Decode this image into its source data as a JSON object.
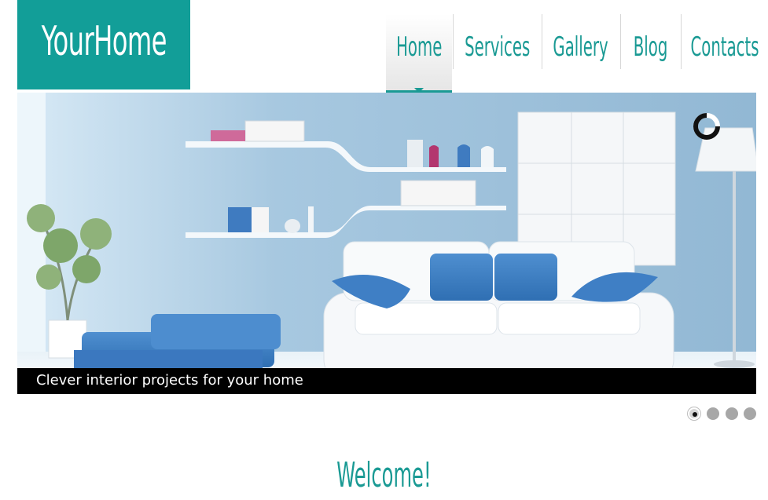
{
  "brand": {
    "logo_text": "YourHome",
    "accent_color": "#129e98"
  },
  "nav": {
    "items": [
      {
        "label": "Home",
        "active": true
      },
      {
        "label": "Services",
        "active": false
      },
      {
        "label": "Gallery",
        "active": false
      },
      {
        "label": "Blog",
        "active": false
      },
      {
        "label": "Contacts",
        "active": false
      }
    ]
  },
  "slider": {
    "caption": "Clever interior projects for your home",
    "slide_count": 4,
    "active_slide": 1,
    "loader_icon": "loading-spinner"
  },
  "welcome": {
    "title": "Welcome!"
  }
}
